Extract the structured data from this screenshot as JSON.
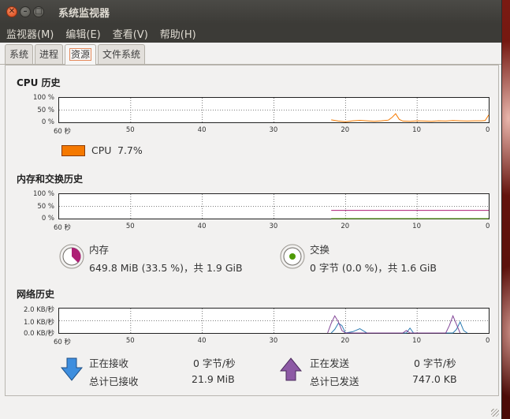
{
  "window": {
    "title": "系统监视器"
  },
  "menu": [
    "监视器(M)",
    "编辑(E)",
    "查看(V)",
    "帮助(H)"
  ],
  "tabs": [
    "系统",
    "进程",
    "资源",
    "文件系统"
  ],
  "active_tab": "资源",
  "cpu": {
    "title": "CPU 历史",
    "y_ticks": [
      "100 %",
      "50 %",
      "0 %"
    ],
    "x_ticks": [
      "60 秒",
      "50",
      "40",
      "30",
      "20",
      "10",
      "0"
    ],
    "legend_label": "CPU",
    "legend_value": "7.7%",
    "color": "#f57900"
  },
  "memory": {
    "title": "内存和交换历史",
    "y_ticks": [
      "100 %",
      "50 %",
      "0 %"
    ],
    "x_ticks": [
      "60 秒",
      "50",
      "40",
      "30",
      "20",
      "10",
      "0"
    ],
    "mem_label": "内存",
    "mem_value": "649.8 MiB (33.5 %)，共 1.9 GiB",
    "swap_label": "交换",
    "swap_value": "0 字节 (0.0 %)，共 1.6 GiB",
    "mem_color": "#ad1f75",
    "swap_color": "#4e9a06"
  },
  "network": {
    "title": "网络历史",
    "y_ticks": [
      "2.0 KB/秒",
      "1.0 KB/秒",
      "0.0 KB/秒"
    ],
    "x_ticks": [
      "60 秒",
      "50",
      "40",
      "30",
      "20",
      "10",
      "0"
    ],
    "recv_label": "正在接收",
    "recv_rate": "0 字节/秒",
    "recv_total_label": "总计已接收",
    "recv_total": "21.9 MiB",
    "send_label": "正在发送",
    "send_rate": "0 字节/秒",
    "send_total_label": "总计已发送",
    "send_total": "747.0 KB",
    "recv_color": "#2d7db3",
    "send_color": "#844798"
  },
  "chart_data": [
    {
      "type": "line",
      "title": "CPU 历史",
      "xlabel": "",
      "ylabel": "",
      "xlim": [
        60,
        0
      ],
      "ylim": [
        0,
        100
      ],
      "series": [
        {
          "name": "CPU",
          "x": [
            22,
            21,
            20,
            19,
            18,
            17,
            16,
            15,
            14,
            13.5,
            13,
            12.5,
            12,
            11,
            10,
            9,
            8,
            7,
            6,
            5,
            4,
            3,
            2,
            1,
            0.5,
            0
          ],
          "y": [
            10,
            5,
            2,
            6,
            8,
            6,
            4,
            6,
            9,
            20,
            35,
            12,
            5,
            4,
            6,
            5,
            4,
            6,
            5,
            7,
            6,
            5,
            6,
            6,
            7,
            30
          ]
        }
      ]
    },
    {
      "type": "line",
      "title": "内存和交换历史",
      "xlim": [
        60,
        0
      ],
      "ylim": [
        0,
        100
      ],
      "series": [
        {
          "name": "内存",
          "x": [
            22,
            0
          ],
          "y": [
            33.5,
            33.5
          ]
        },
        {
          "name": "交换",
          "x": [
            22,
            0
          ],
          "y": [
            0,
            0
          ]
        }
      ]
    },
    {
      "type": "line",
      "title": "网络历史",
      "xlim": [
        60,
        0
      ],
      "ylim": [
        0,
        2.0
      ],
      "series": [
        {
          "name": "正在接收",
          "x": [
            22,
            21.5,
            21,
            20.5,
            20,
            19,
            18,
            17,
            11.5,
            11,
            10.5,
            5,
            4.5,
            4,
            3.5,
            3
          ],
          "y": [
            0,
            0.3,
            0.8,
            0.6,
            0,
            0.1,
            0.35,
            0,
            0,
            0.4,
            0,
            0,
            0.3,
            0.9,
            0.2,
            0
          ]
        },
        {
          "name": "正在发送",
          "x": [
            22.5,
            22,
            21.5,
            21,
            20.5,
            20,
            12,
            11.5,
            11,
            10.5,
            6,
            5.5,
            5,
            4.5,
            4
          ],
          "y": [
            0,
            0.8,
            1.4,
            0.9,
            0.2,
            0,
            0,
            0.2,
            0,
            0,
            0,
            0.6,
            1.4,
            0.7,
            0
          ]
        }
      ]
    }
  ]
}
